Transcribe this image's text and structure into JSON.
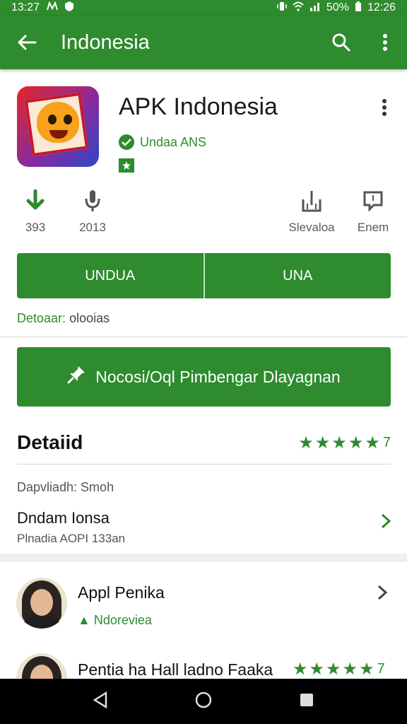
{
  "status_bar": {
    "time_left": "13:27",
    "battery": "50%",
    "time_right": "12:26"
  },
  "app_bar": {
    "title": "Indonesia",
    "back_icon": "back-arrow-icon",
    "search_icon": "search-icon",
    "menu_icon": "overflow-menu-icon"
  },
  "app": {
    "name": "APK Indonesia",
    "developer": "Undaa ANS",
    "stats": [
      {
        "label": "393",
        "icon": "download-icon"
      },
      {
        "label": "2013",
        "icon": "microphone-icon"
      },
      {
        "label": "Slevaloa",
        "icon": "share-icon"
      },
      {
        "label": "Enem",
        "icon": "message-icon"
      }
    ]
  },
  "buttons": {
    "left_label": "UNDUA",
    "right_label": "UNA"
  },
  "detail_link": {
    "label": "Detoaar:",
    "value": "olooias"
  },
  "promo_button": {
    "label": "Nocosi/Oql Pimbengar Dlayagnan"
  },
  "details": {
    "title": "Detaiid",
    "rating": "7",
    "stars_count": 5,
    "subtitle": "Dapvliadh: Smoh",
    "row_name": "Dndam Ionsa",
    "row_meta": "Plnadia AOPI 133an"
  },
  "reviews": [
    {
      "name": "Appl Penika",
      "sub": "Ndoreviea"
    },
    {
      "name": "Pentia ha Hall ladno Faaka",
      "rating": "7"
    }
  ],
  "colors": {
    "primary": "#2e8b2e",
    "nav_bar": "#000000"
  }
}
